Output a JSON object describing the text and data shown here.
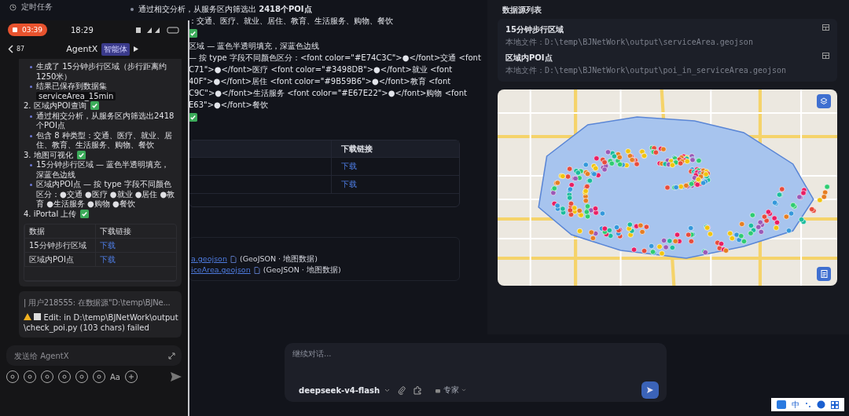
{
  "sidebar": {
    "items": [
      {
        "label": "定时任务"
      }
    ]
  },
  "main": {
    "blocks": [
      {
        "kind": "bullet",
        "text": "通过相交分析，从服务区内筛选出 **2418个POI点**"
      },
      {
        "kind": "text",
        "text": "：交通、医疗、就业、居住、教育、生活服务、购物、餐饮"
      },
      {
        "kind": "check"
      },
      {
        "kind": "text",
        "text": "区域 — 蓝色半透明填充，深蓝色边线"
      },
      {
        "kind": "text",
        "text": "— 按 type 字段不同颜色区分：<font color=\"#E74C3C\">●</font>交通 <font"
      },
      {
        "kind": "text",
        "text": "C71\">●</font>医疗 <font color=\"#3498DB\">●</font>就业 <font"
      },
      {
        "kind": "text",
        "text": "40F\">●</font>居住 <font color=\"#9B59B6\">●</font>教育 <font"
      },
      {
        "kind": "text",
        "text": "C9C\">●</font>生活服务 <font color=\"#E67E22\">●</font>购物 <font"
      },
      {
        "kind": "text",
        "text": "E63\">●</font>餐饮"
      },
      {
        "kind": "check"
      }
    ],
    "table": {
      "columns": [
        "下载链接"
      ],
      "rows": [
        [
          "下载"
        ],
        [
          "下载"
        ]
      ]
    },
    "files": [
      {
        "link": "a.geojson",
        "note": "(GeoJSON · 地图数据)"
      },
      {
        "link": "iceArea.geojson",
        "note": "(GeoJSON · 地图数据)"
      }
    ]
  },
  "right_panel": {
    "title": "数据源列表",
    "sources": [
      {
        "name": "15分钟步行区域",
        "path": "本地文件：D:\\temp\\BJNetWork\\output\\serviceArea.geojson"
      },
      {
        "name": "区域内POI点",
        "path": "本地文件：D:\\temp\\BJNetWork\\output\\poi_in_serviceArea.geojson"
      }
    ]
  },
  "composer": {
    "placeholder": "继续对话...",
    "model": "deepseek-v4-flash",
    "mode": "专家"
  },
  "tray": {
    "ime": "中"
  },
  "phone": {
    "status": {
      "recording": "03:39",
      "time": "18:29"
    },
    "header": {
      "back_count": "87",
      "title": "AgentX",
      "badge": "智能体"
    },
    "reply": {
      "blocks": [
        {
          "kind": "bullet",
          "text": "生成了 15分钟步行区域（步行距离约1250米）"
        },
        {
          "kind": "bullet",
          "text": "结果已保存到数据集",
          "code": "serviceArea_15min"
        },
        {
          "kind": "heading",
          "text": "2. 区域内POI查询"
        },
        {
          "kind": "bullet",
          "text": "通过相交分析，从服务区内筛选出2418个POI点"
        },
        {
          "kind": "bullet",
          "text": "包含 8 种类型：交通、医疗、就业、居住、教育、生活服务、购物、餐饮"
        },
        {
          "kind": "heading",
          "text": "3. 地图可视化"
        },
        {
          "kind": "bullet",
          "text": "15分钟步行区域 — 蓝色半透明填充，深蓝色边线"
        },
        {
          "kind": "bullet",
          "text": "区域内POI点 — 按 type 字段不同颜色区分：●交通 ●医疗 ●就业 ●居住 ●教育 ●生活服务 ●购物 ●餐饮"
        },
        {
          "kind": "heading",
          "text": "4. iPortal 上传"
        }
      ],
      "table": {
        "columns": [
          "数据",
          "下载链接"
        ],
        "rows": [
          [
            "15分钟步行区域",
            "下载"
          ],
          [
            "区域内POI点",
            "下载"
          ]
        ]
      }
    },
    "status_message": {
      "quote": "| 用户218555: 在数据源\"D:\\temp\\BJNe...",
      "error": "Edit: in D:\\temp\\BJNetWork\\output\\check_poi.py (103 chars) failed"
    },
    "input": {
      "placeholder": "发送给 AgentX"
    },
    "toolbar": {
      "font_label": "Aa"
    }
  }
}
